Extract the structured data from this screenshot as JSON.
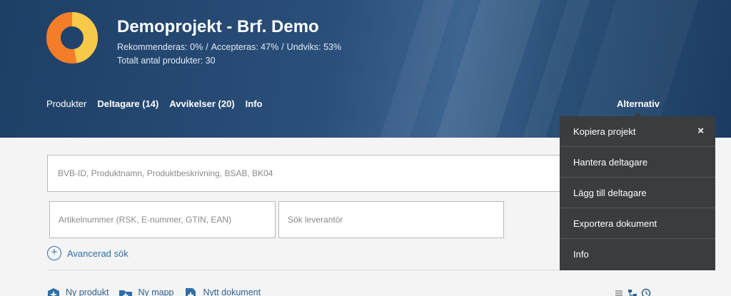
{
  "project": {
    "title": "Demoprojekt - Brf. Demo",
    "stats": {
      "recommended": "Rekommenderas: 0%",
      "accepted": "Accepteras: 47%",
      "avoided": "Undviks: 53%"
    },
    "total": "Totalt antal produkter: 30",
    "donut": {
      "recommended": 0,
      "accepted": 47,
      "avoided": 53,
      "colors": {
        "accepted": "#f7c948",
        "avoided": "#f47d2a"
      }
    }
  },
  "tabs": [
    {
      "label": "Produkter"
    },
    {
      "label": "Deltagare (14)"
    },
    {
      "label": "Avvikelser (20)"
    },
    {
      "label": "Info"
    }
  ],
  "alternativ": {
    "label": "Alternativ"
  },
  "menu": {
    "items": [
      {
        "label": "Kopiera projekt"
      },
      {
        "label": "Hantera deltagare"
      },
      {
        "label": "Lägg till deltagare"
      },
      {
        "label": "Exportera dokument"
      },
      {
        "label": "Info"
      }
    ],
    "close": "×"
  },
  "search": {
    "main_placeholder": "BVB-ID, Produktnamn, Produktbeskrivning, BSAB, BK04",
    "article_placeholder": "Artikelnummer (RSK, E-nummer, GTIN, EAN)",
    "supplier_placeholder": "Sök leverantör",
    "advanced_label": "Avancerad sök"
  },
  "toolbar": {
    "new_product": "Ny produkt",
    "new_folder": "Ny mapp",
    "new_document": "Nytt dokument"
  },
  "colors": {
    "accent": "#2f6fa8",
    "menu_bg": "#3a3c3e",
    "header_bg": "#1e3f66"
  }
}
